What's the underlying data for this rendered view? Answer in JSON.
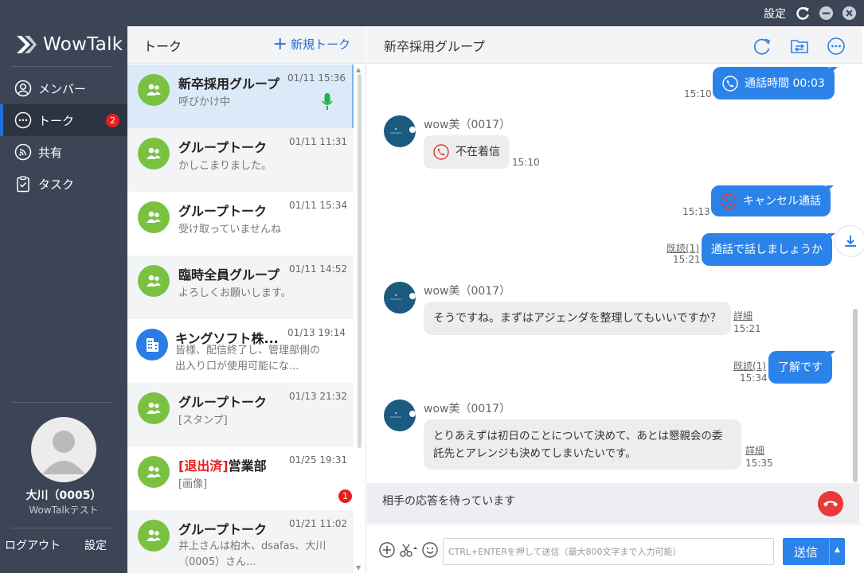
{
  "titlebar": {
    "settings_label": "設定",
    "icons": [
      "refresh-icon",
      "minimize-icon",
      "close-icon"
    ]
  },
  "sidebar": {
    "logo_text": "WowTalk",
    "items": [
      {
        "label": "メンバー",
        "icon": "person-icon"
      },
      {
        "label": "トーク",
        "icon": "chat-bubble-icon",
        "badge": "2",
        "active": true
      },
      {
        "label": "共有",
        "icon": "share-icon"
      },
      {
        "label": "タスク",
        "icon": "clipboard-icon"
      }
    ],
    "profile": {
      "name": "大川（0005）",
      "org": "WowTalkテスト"
    },
    "logout_label": "ログアウト",
    "settings_label": "設定"
  },
  "list": {
    "title": "トーク",
    "new_label": "新規トーク",
    "conversations": [
      {
        "name": "新卒採用グループ",
        "time": "01/11 15:36",
        "preview": "呼びかけ中",
        "icon": "group-icon",
        "mic": true,
        "selected": true
      },
      {
        "name": "グループトーク",
        "time": "01/11 11:31",
        "preview": "かしこまりました。",
        "icon": "group-icon"
      },
      {
        "name": "グループトーク",
        "time": "01/11 15:34",
        "preview": "受け取っていませんね",
        "icon": "group-icon"
      },
      {
        "name": "臨時全員グループ",
        "time": "01/11 14:52",
        "preview": "よろしくお願いします。",
        "icon": "group-icon"
      },
      {
        "name": "キングソフト株...",
        "time": "01/13 19:14",
        "preview": "皆様、配信終了し、管理部側の出入り口が使用可能にな...",
        "icon": "building-icon"
      },
      {
        "name": "グループトーク",
        "time": "01/13 21:32",
        "preview": "[スタンプ]",
        "icon": "group-icon"
      },
      {
        "name_prefix": "[退出済]",
        "name": "営業部",
        "time": "01/25 19:31",
        "preview": "[画像]",
        "icon": "group-icon",
        "badge": "1"
      },
      {
        "name": "グループトーク",
        "time": "01/21 11:02",
        "preview": "井上さんは柏木、dsafas、大川（0005）さん...",
        "icon": "group-icon"
      }
    ]
  },
  "chat": {
    "title": "新卒採用グループ",
    "header_icons": [
      "refresh-icon",
      "transfer-icon",
      "more-icon"
    ],
    "messages": [
      {
        "dir": "out",
        "text": "通話時間 00:03",
        "time": "15:10",
        "icon": "phone-icon"
      },
      {
        "dir": "in",
        "sender": "wow美（0017）",
        "text": "不在着信",
        "time": "15:10",
        "icon": "missed-call-icon"
      },
      {
        "dir": "out",
        "text": "キャンセル通話",
        "time": "15:13",
        "icon": "cancel-call-icon"
      },
      {
        "dir": "out",
        "text": "通話で話しましょうか",
        "time": "15:21",
        "read": "既読(1)"
      },
      {
        "dir": "in",
        "sender": "wow美（0017）",
        "text": "そうですね。まずはアジェンダを整理してもいいですか？",
        "time": "15:21",
        "detail": "詳細"
      },
      {
        "dir": "out",
        "text": "了解です",
        "time": "15:34",
        "read": "既読(1)"
      },
      {
        "dir": "in",
        "sender": "wow美（0017）",
        "text": "とりあえずは初日のことについて決めて、あとは懇親会の委託先とアレンジも決めてしまいたいです。",
        "time": "15:35",
        "detail": "詳細"
      }
    ],
    "waiting_text": "相手の応答を待っています",
    "input_placeholder": "CTRL+ENTERを押して送信（最大800文字まで入力可能）",
    "send_label": "送信",
    "colors": {
      "accent": "#2b83ea",
      "sidebar": "#3c4556",
      "badge": "#e81e1e",
      "avatar_green": "#7ac142"
    }
  }
}
